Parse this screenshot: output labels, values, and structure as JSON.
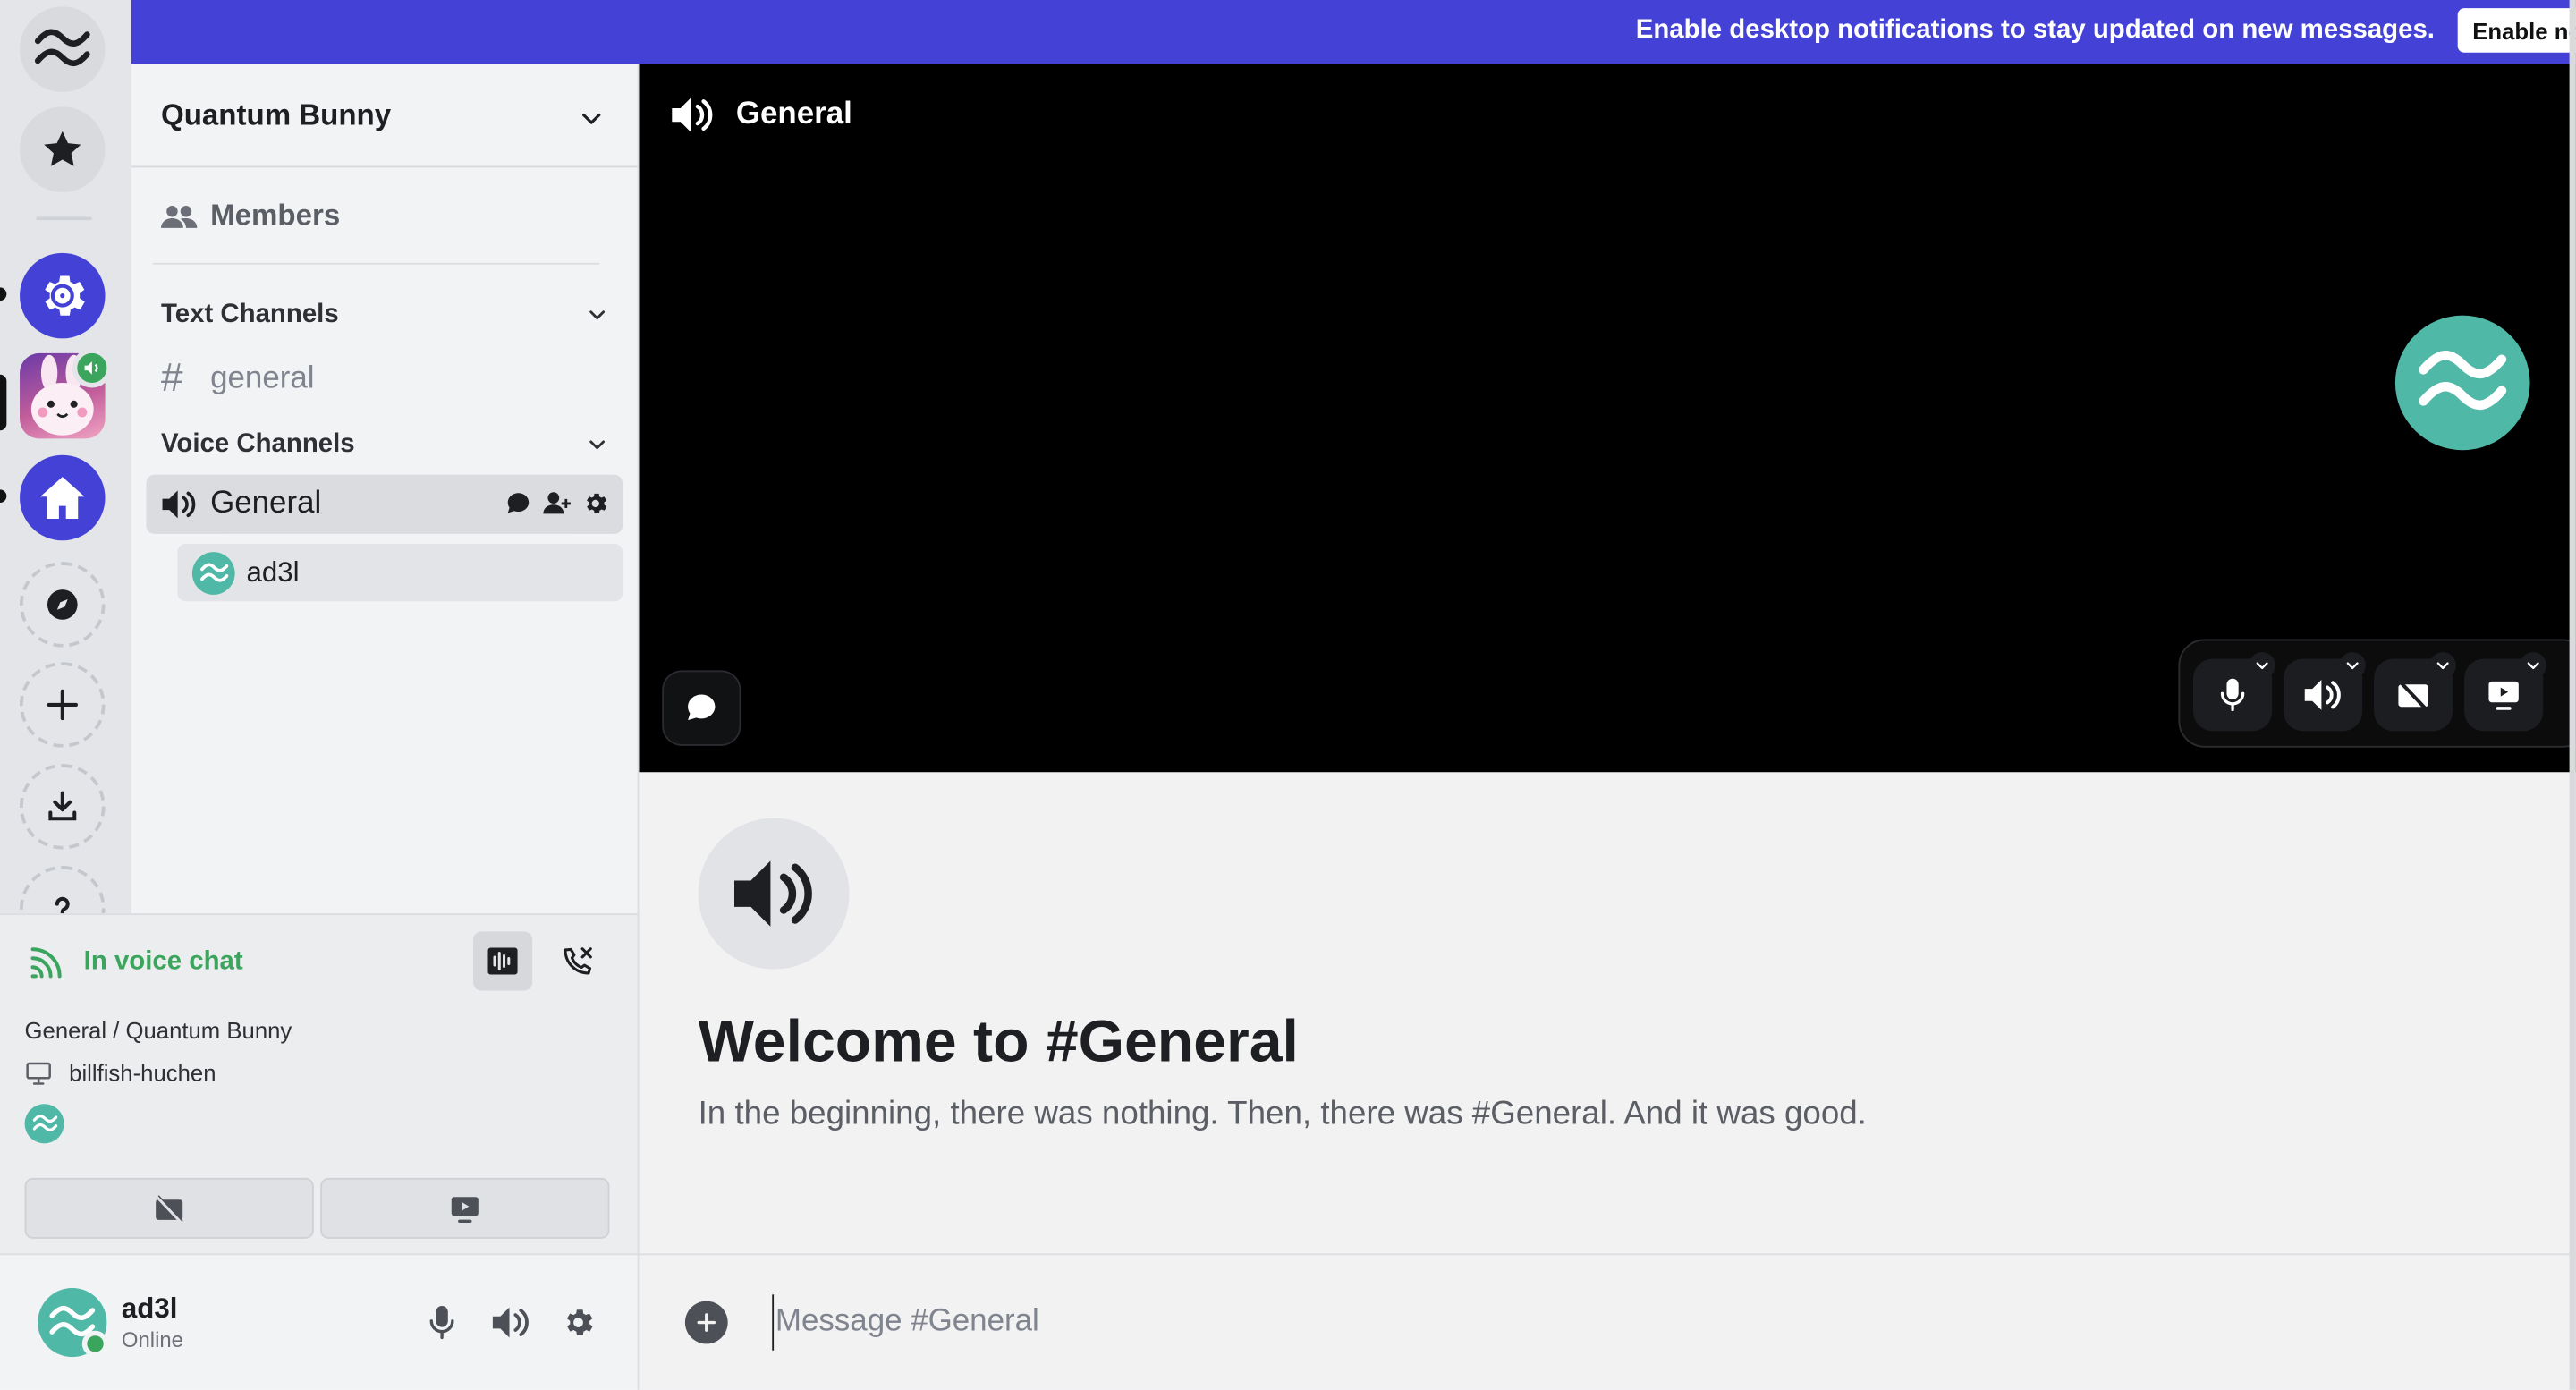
{
  "notification": {
    "text": "Enable desktop notifications to stay updated on new messages.",
    "button_label": "Enable no"
  },
  "server": {
    "name": "Quantum Bunny",
    "members_label": "Members"
  },
  "categories": {
    "text_label": "Text Channels",
    "voice_label": "Voice Channels"
  },
  "channels": {
    "text": [
      {
        "name": "general"
      }
    ],
    "voice": [
      {
        "name": "General",
        "participants": [
          {
            "name": "ad3l"
          }
        ]
      }
    ]
  },
  "voice_panel": {
    "status": "In voice chat",
    "location": "General / Quantum Bunny",
    "device": "billfish-huchen"
  },
  "user": {
    "name": "ad3l",
    "status": "Online"
  },
  "main": {
    "channel_title": "General",
    "welcome_title": "Welcome to #General",
    "welcome_text": "In the beginning, there was nothing. Then, there was #General. And it was good.",
    "composer_placeholder": "Message #General"
  },
  "colors": {
    "brand": "#4442d6",
    "online": "#3ba55d",
    "avatar": "#4fb8a6",
    "video_bg": "#000000"
  }
}
